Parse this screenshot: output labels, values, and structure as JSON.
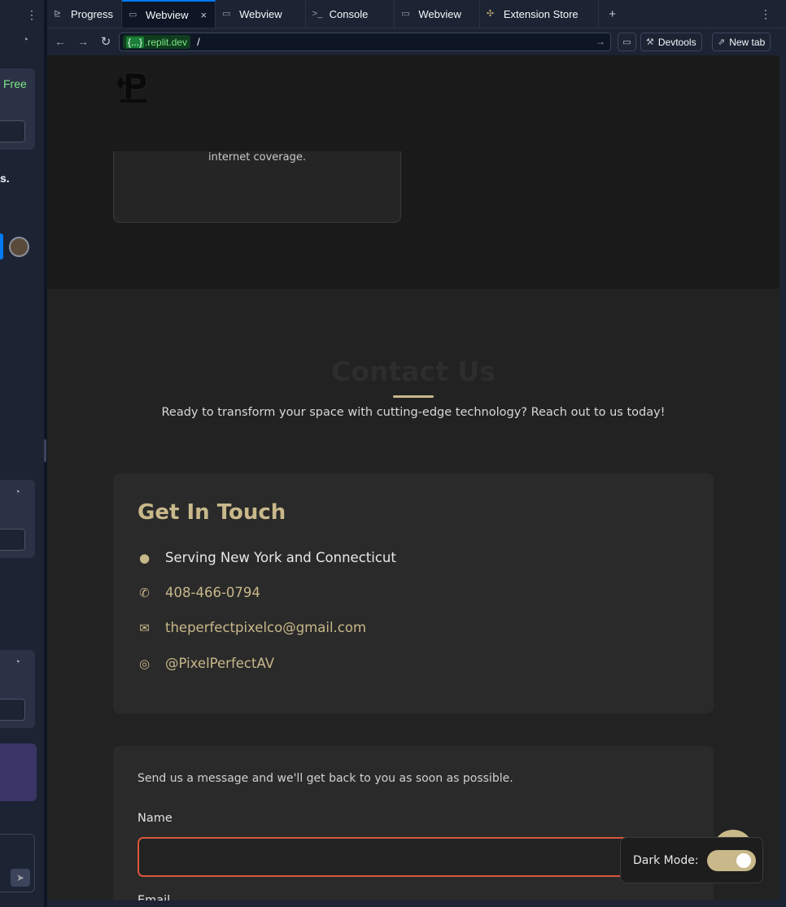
{
  "tabs": [
    {
      "label": "Progress",
      "icon": "progress-icon",
      "active": false
    },
    {
      "label": "Webview",
      "icon": "monitor-icon",
      "active": true
    },
    {
      "label": "Webview",
      "icon": "monitor-icon",
      "active": false
    },
    {
      "label": "Console",
      "icon": "terminal-icon",
      "active": false
    },
    {
      "label": "Webview",
      "icon": "monitor-icon",
      "active": false
    },
    {
      "label": "Extension Store",
      "icon": "puzzle-icon",
      "active": false
    }
  ],
  "address": {
    "chip_brace": "{...}",
    "domain": ".replit.dev",
    "path": "/",
    "devtools_label": "Devtools",
    "newtab_label": "New tab"
  },
  "left_pane": {
    "free_label": "Free",
    "partial_text": "s."
  },
  "site": {
    "service_text": "Mesh WiFi systems that provide reliable, whole-home internet coverage.",
    "contact_title": "Contact Us",
    "contact_sub": "Ready to transform your space with cutting-edge technology? Reach out to us today!",
    "get_in_touch": "Get In Touch",
    "location": "Serving New York and Connecticut",
    "phone": "408-466-0794",
    "email": "theperfectpixelco@gmail.com",
    "instagram": "@PixelPerfectAV",
    "form_intro": "Send us a message and we'll get back to you as soon as possible.",
    "name_label": "Name",
    "email_label_partial": "Email",
    "dark_mode_label": "Dark Mode:",
    "dark_mode_on": true
  },
  "colors": {
    "accent": "#c8b88a",
    "error_border": "#d9573f",
    "replit_blue": "#0079f2"
  }
}
